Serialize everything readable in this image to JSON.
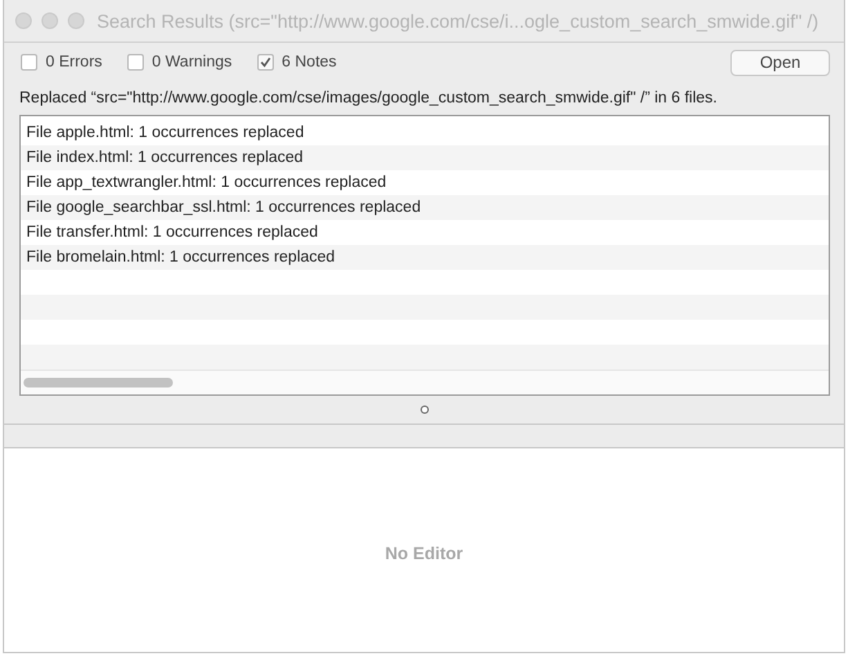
{
  "window": {
    "title": "Search Results (src=\"http://www.google.com/cse/i...ogle_custom_search_smwide.gif\" /)"
  },
  "filters": [
    {
      "label": "0 Errors",
      "checked": false
    },
    {
      "label": "0 Warnings",
      "checked": false
    },
    {
      "label": "6 Notes",
      "checked": true
    }
  ],
  "open_button": "Open",
  "summary": "Replaced “src=\"http://www.google.com/cse/images/google_custom_search_smwide.gif\" /” in 6 files.",
  "results": [
    "File apple.html: 1 occurrences replaced",
    "File index.html: 1 occurrences replaced",
    "File app_textwrangler.html: 1 occurrences replaced",
    "File google_searchbar_ssl.html: 1 occurrences replaced",
    "File transfer.html: 1 occurrences replaced",
    "File bromelain.html: 1 occurrences replaced"
  ],
  "editor": {
    "placeholder": "No Editor"
  }
}
